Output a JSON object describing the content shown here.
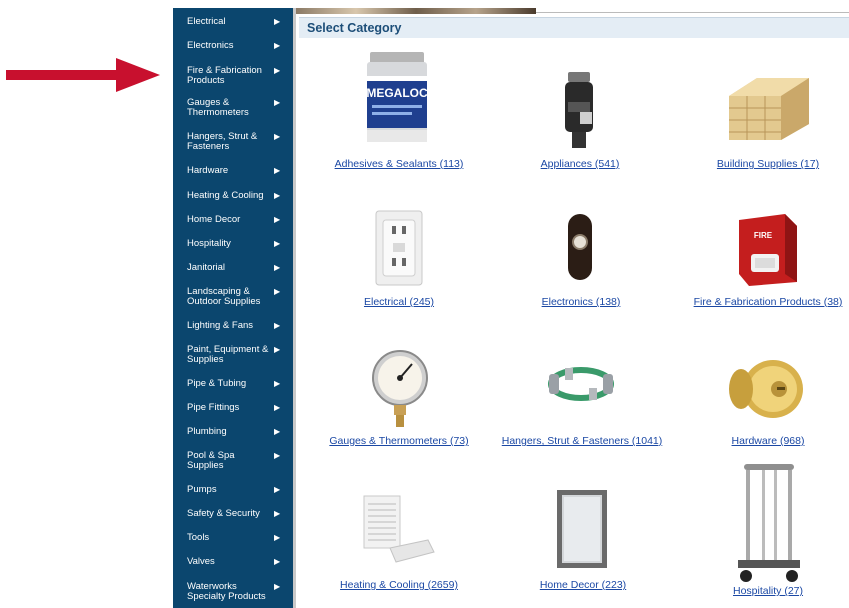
{
  "sidebar": {
    "items": [
      {
        "label": "Electrical"
      },
      {
        "label": "Electronics"
      },
      {
        "label": "Fire & Fabrication Products"
      },
      {
        "label": "Gauges & Thermometers"
      },
      {
        "label": "Hangers, Strut & Fasteners"
      },
      {
        "label": "Hardware"
      },
      {
        "label": "Heating & Cooling"
      },
      {
        "label": "Home Decor"
      },
      {
        "label": "Hospitality"
      },
      {
        "label": "Janitorial"
      },
      {
        "label": "Landscaping & Outdoor Supplies"
      },
      {
        "label": "Lighting & Fans"
      },
      {
        "label": "Paint, Equipment & Supplies"
      },
      {
        "label": "Pipe & Tubing"
      },
      {
        "label": "Pipe Fittings"
      },
      {
        "label": "Plumbing"
      },
      {
        "label": "Pool & Spa Supplies"
      },
      {
        "label": "Pumps"
      },
      {
        "label": "Safety & Security"
      },
      {
        "label": "Tools"
      },
      {
        "label": "Valves"
      },
      {
        "label": "Waterworks Specialty Products"
      }
    ]
  },
  "main": {
    "header": "Select Category",
    "categories": [
      {
        "label": "Adhesives & Sealants (113)",
        "icon": "adhesive-can-icon",
        "product_label": "MEGALOC"
      },
      {
        "label": "Appliances (541)",
        "icon": "garbage-disposal-icon"
      },
      {
        "label": "Building Supplies (17)",
        "icon": "lumber-stack-icon"
      },
      {
        "label": "Electrical (245)",
        "icon": "wall-outlet-icon"
      },
      {
        "label": "Electronics (138)",
        "icon": "doorbell-button-icon"
      },
      {
        "label": "Fire & Fabrication Products (38)",
        "icon": "fire-alarm-strobe-icon",
        "product_label": "FIRE"
      },
      {
        "label": "Gauges & Thermometers (73)",
        "icon": "pressure-gauge-icon"
      },
      {
        "label": "Hangers, Strut & Fasteners (1041)",
        "icon": "hanger-clamps-icon"
      },
      {
        "label": "Hardware (968)",
        "icon": "door-knob-icon"
      },
      {
        "label": "Heating & Cooling (2659)",
        "icon": "air-vent-grille-icon"
      },
      {
        "label": "Home Decor (223)",
        "icon": "wall-mirror-icon"
      },
      {
        "label": "Hospitality (27)",
        "icon": "luggage-cart-icon"
      }
    ]
  },
  "annotation": {
    "arrow_color": "#c8102e"
  },
  "colors": {
    "sidebar_bg": "#0b466e",
    "link": "#1b48a4",
    "header_text": "#1d4e78",
    "header_bg": "#e4edf5"
  }
}
